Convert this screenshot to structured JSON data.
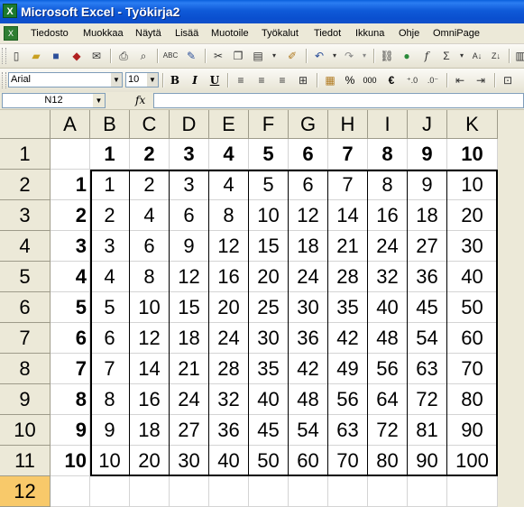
{
  "window": {
    "title": "Microsoft Excel - Työkirja2",
    "app_icon": "excel-icon"
  },
  "menu": {
    "items": [
      "Tiedosto",
      "Muokkaa",
      "Näytä",
      "Lisää",
      "Muotoile",
      "Työkalut",
      "Tiedot",
      "Ikkuna",
      "Ohje",
      "OmniPage"
    ]
  },
  "format_toolbar": {
    "font": "Arial",
    "size": "10",
    "bold": "B",
    "italic": "I",
    "underline": "U",
    "percent": "%",
    "thousands": "000",
    "currency": "€"
  },
  "formula_bar": {
    "name_box": "N12",
    "fx": "fx",
    "content": ""
  },
  "sheet": {
    "columns": [
      "A",
      "B",
      "C",
      "D",
      "E",
      "F",
      "G",
      "H",
      "I",
      "J",
      "K"
    ],
    "rows": [
      "1",
      "2",
      "3",
      "4",
      "5",
      "6",
      "7",
      "8",
      "9",
      "10",
      "11",
      "12"
    ],
    "active_row": "12",
    "header_row": [
      "",
      "1",
      "2",
      "3",
      "4",
      "5",
      "6",
      "7",
      "8",
      "9",
      "10"
    ],
    "body": [
      [
        "1",
        "1",
        "2",
        "3",
        "4",
        "5",
        "6",
        "7",
        "8",
        "9",
        "10"
      ],
      [
        "2",
        "2",
        "4",
        "6",
        "8",
        "10",
        "12",
        "14",
        "16",
        "18",
        "20"
      ],
      [
        "3",
        "3",
        "6",
        "9",
        "12",
        "15",
        "18",
        "21",
        "24",
        "27",
        "30"
      ],
      [
        "4",
        "4",
        "8",
        "12",
        "16",
        "20",
        "24",
        "28",
        "32",
        "36",
        "40"
      ],
      [
        "5",
        "5",
        "10",
        "15",
        "20",
        "25",
        "30",
        "35",
        "40",
        "45",
        "50"
      ],
      [
        "6",
        "6",
        "12",
        "18",
        "24",
        "30",
        "36",
        "42",
        "48",
        "54",
        "60"
      ],
      [
        "7",
        "7",
        "14",
        "21",
        "28",
        "35",
        "42",
        "49",
        "56",
        "63",
        "70"
      ],
      [
        "8",
        "8",
        "16",
        "24",
        "32",
        "40",
        "48",
        "56",
        "64",
        "72",
        "80"
      ],
      [
        "9",
        "9",
        "18",
        "27",
        "36",
        "45",
        "54",
        "63",
        "72",
        "81",
        "90"
      ],
      [
        "10",
        "10",
        "20",
        "30",
        "40",
        "50",
        "60",
        "70",
        "80",
        "90",
        "100"
      ]
    ]
  }
}
